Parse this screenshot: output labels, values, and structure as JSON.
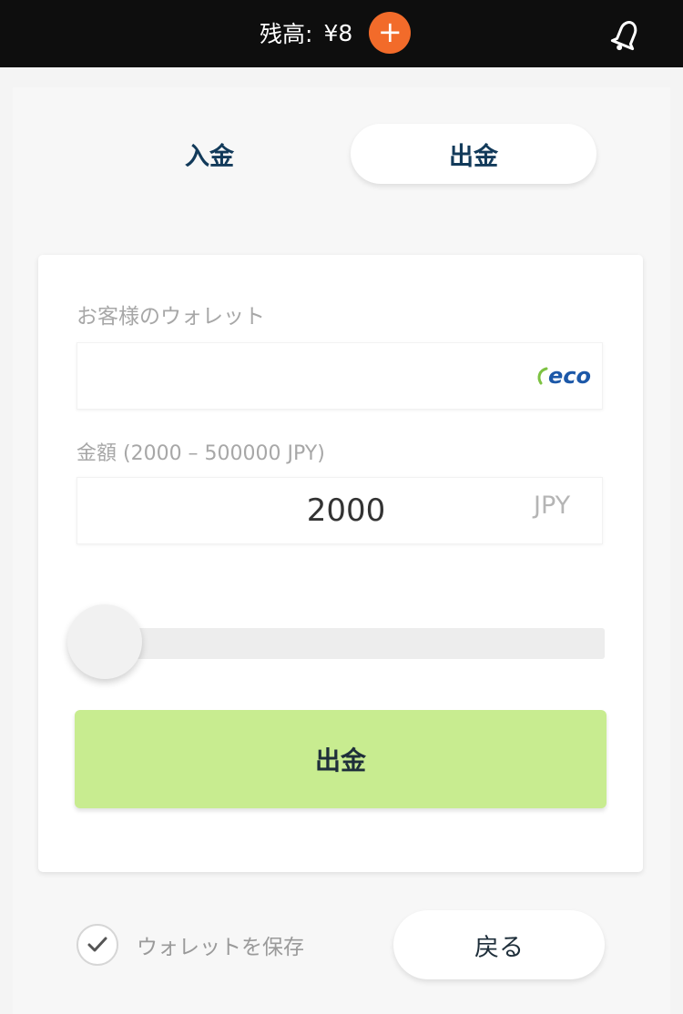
{
  "header": {
    "balance_label": "残高:",
    "balance_value": "¥8",
    "add_label": "+"
  },
  "tabs": {
    "deposit": "入金",
    "withdraw": "出金",
    "active": "withdraw"
  },
  "form": {
    "wallet_label": "お客様のウォレット",
    "wallet_value": "",
    "wallet_logo": "eco",
    "amount_label": "金額 (2000 – 500000 JPY)",
    "amount_value": "2000",
    "currency": "JPY",
    "slider_level": 0,
    "submit_label": "出金"
  },
  "footer": {
    "save_wallet_label": "ウォレットを保存",
    "save_wallet_checked": true,
    "back_label": "戻る"
  },
  "colors": {
    "topbar": "#0e0e0e",
    "accent_orange": "#f26b2a",
    "submit_green": "#c8ec90",
    "eco_blue": "#1c58a8",
    "eco_green": "#7dc242"
  },
  "icons": {
    "bell": "bell-icon",
    "add": "plus-icon",
    "check": "check-icon",
    "wallet_logo": "ecopayz-logo"
  }
}
